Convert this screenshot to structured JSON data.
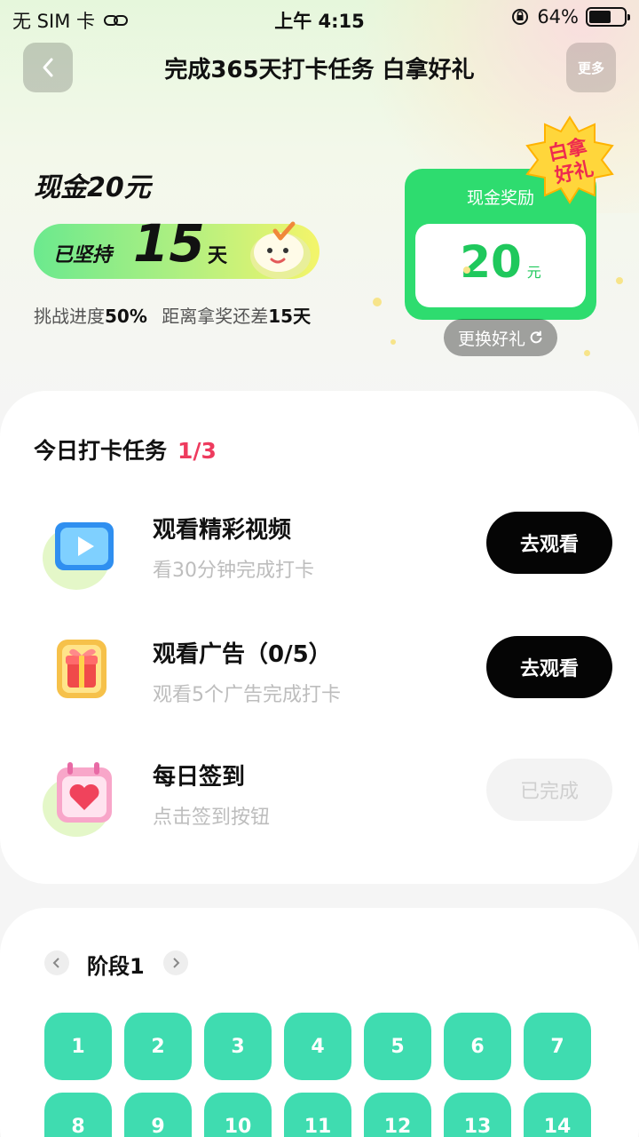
{
  "status_bar": {
    "carrier": "无 SIM 卡",
    "time": "上午 4:15",
    "battery_text": "64%",
    "battery_level": 0.64
  },
  "nav": {
    "title": "完成365天打卡任务 白拿好礼",
    "more_label": "更多"
  },
  "hero": {
    "cash_title": "现金20元",
    "streak_label": "已坚持",
    "streak_days": "15",
    "streak_unit": "天",
    "progress_prefix": "挑战进度",
    "progress_percent": "50%",
    "remain_prefix": "距离拿奖还差",
    "remain_days": "15天"
  },
  "reward": {
    "header": "现金奖励",
    "value": "20",
    "unit": "元",
    "badge_line1": "白拿",
    "badge_line2": "好礼",
    "swap_label": "更换好礼"
  },
  "tasks": {
    "title": "今日打卡任务",
    "count": "1/3",
    "items": [
      {
        "name": "观看精彩视频",
        "desc": "看30分钟完成打卡",
        "button": "去观看",
        "icon": "video-icon",
        "done": false
      },
      {
        "name": "观看广告（0/5）",
        "desc": "观看5个广告完成打卡",
        "button": "去观看",
        "icon": "gift-ad-icon",
        "done": false
      },
      {
        "name": "每日签到",
        "desc": "点击签到按钮",
        "button": "已完成",
        "icon": "calendar-heart-icon",
        "done": true
      }
    ]
  },
  "stage": {
    "label": "阶段1",
    "days": [
      "1",
      "2",
      "3",
      "4",
      "5",
      "6",
      "7",
      "8",
      "9",
      "10",
      "11",
      "12",
      "13",
      "14"
    ]
  },
  "colors": {
    "primary_green": "#2edc6f",
    "day_teal": "#3fdcb0",
    "accent_pink": "#ee3b5e",
    "button_black": "#050505"
  }
}
